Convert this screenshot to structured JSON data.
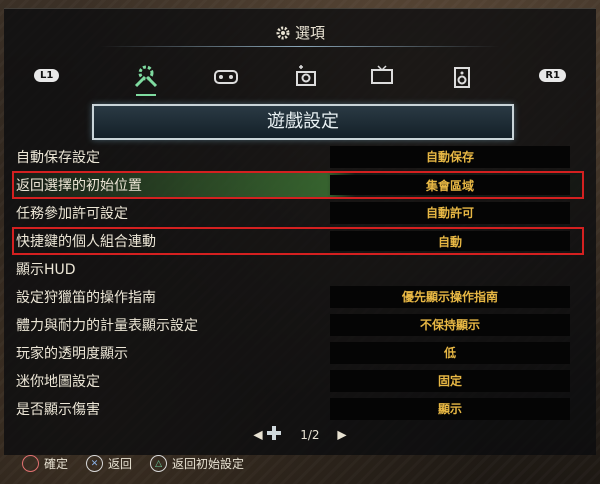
{
  "title": "選項",
  "tabs": {
    "left_button": "L1",
    "right_button": "R1",
    "items": [
      "game-settings-icon",
      "controller-icon",
      "camera-icon",
      "display-icon",
      "sound-icon"
    ]
  },
  "section_title": "遊戲設定",
  "rows": [
    {
      "label": "自動保存設定",
      "value": "自動保存"
    },
    {
      "label": "返回選擇的初始位置",
      "value": "集會區域"
    },
    {
      "label": "任務參加許可設定",
      "value": "自動許可"
    },
    {
      "label": "快捷鍵的個人組合連動",
      "value": "自動"
    },
    {
      "label": "顯示HUD",
      "value": ""
    },
    {
      "label": "設定狩獵笛的操作指南",
      "value": "優先顯示操作指南"
    },
    {
      "label": "體力與耐力的計量表顯示設定",
      "value": "不保持顯示"
    },
    {
      "label": "玩家的透明度顯示",
      "value": "低"
    },
    {
      "label": "迷你地圖設定",
      "value": "固定"
    },
    {
      "label": "是否顯示傷害",
      "value": "顯示"
    }
  ],
  "pager": {
    "page": "1/2"
  },
  "footer": {
    "confirm": "確定",
    "back": "返回",
    "reset": "返回初始設定"
  },
  "colors": {
    "value_text": "#e7b744",
    "highlight_border": "#d42020"
  }
}
